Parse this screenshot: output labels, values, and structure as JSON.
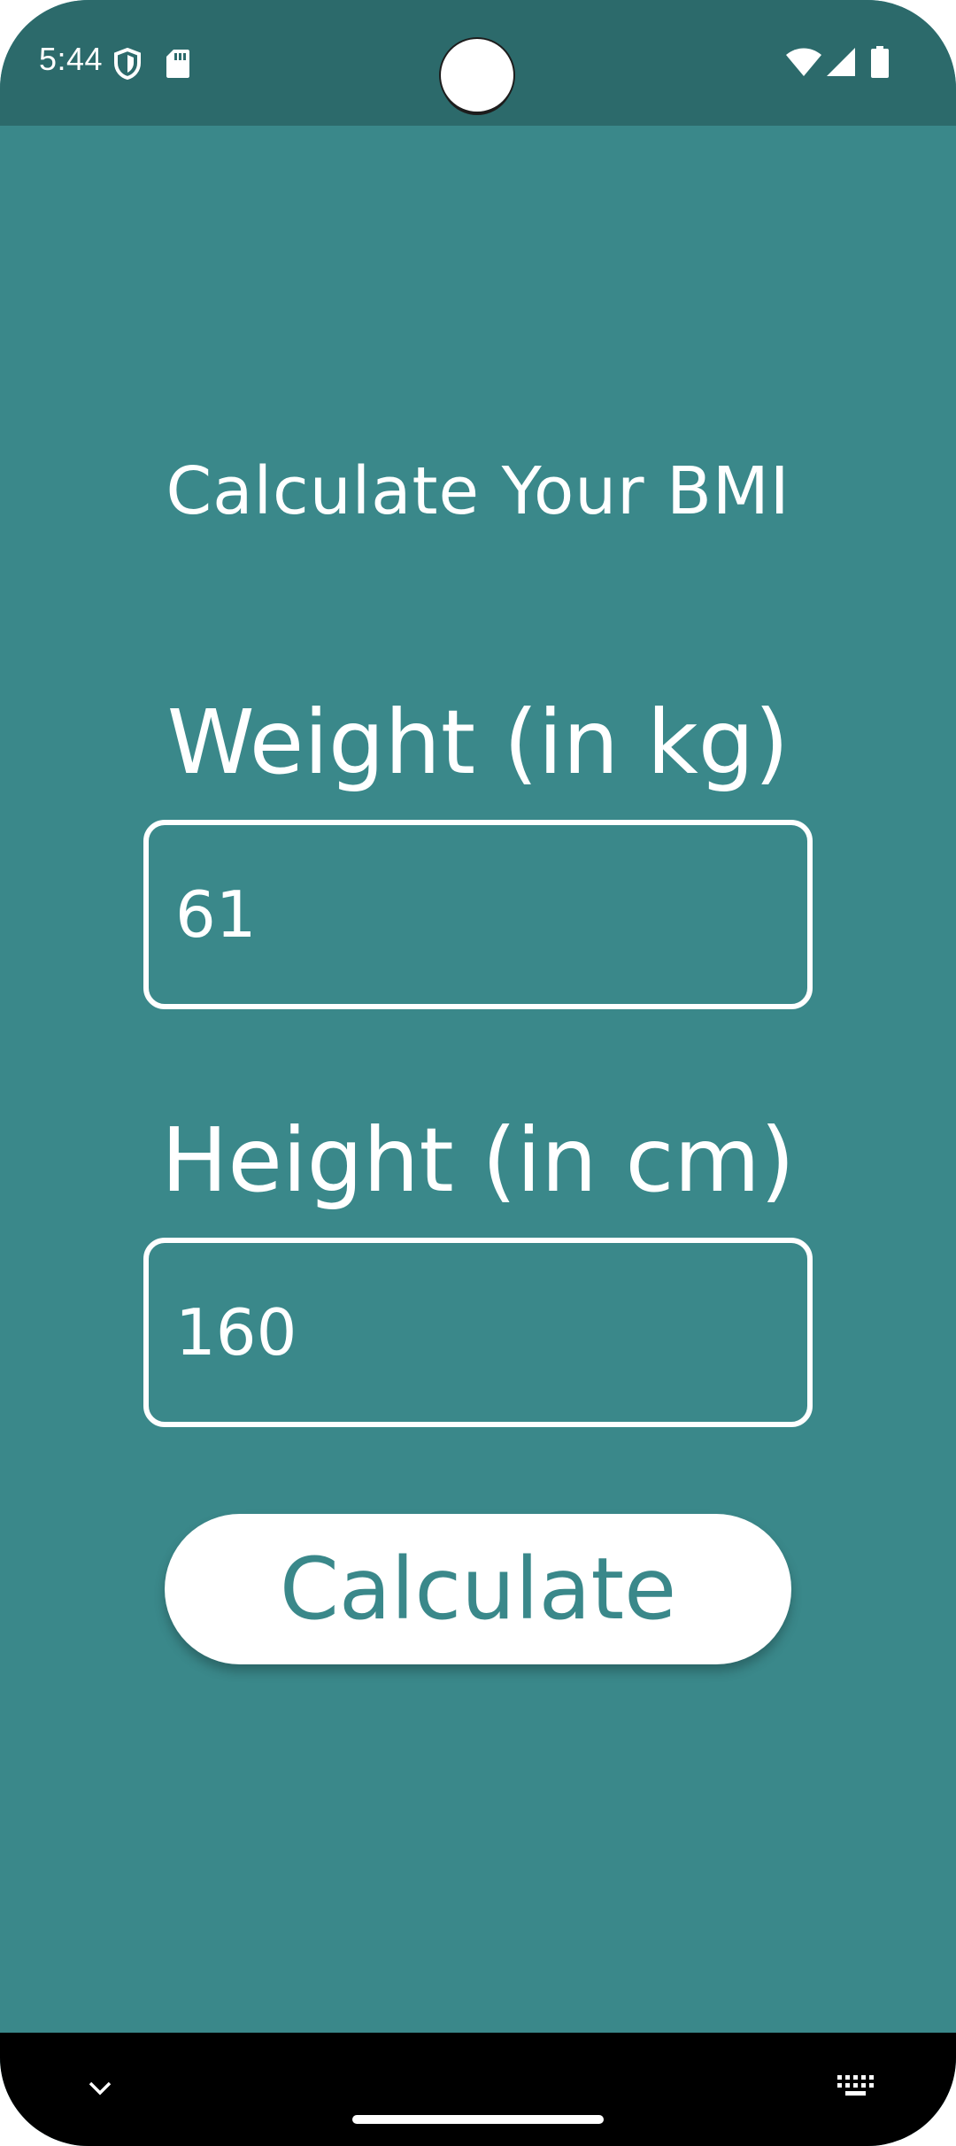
{
  "status_bar": {
    "time": "5:44",
    "icons": [
      "shield-icon",
      "sd-card-icon",
      "wifi-icon",
      "signal-icon",
      "battery-icon"
    ]
  },
  "colors": {
    "background": "#3a888a",
    "status_bar": "#2c6a6b",
    "foreground": "#ffffff",
    "accent": "#3a888a"
  },
  "main": {
    "title": "Calculate Your BMI",
    "weight": {
      "label": "Weight (in kg)",
      "value": "61"
    },
    "height": {
      "label": "Height (in cm)",
      "value": "160"
    },
    "calculate_button": "Calculate"
  },
  "nav_bar": {
    "icons": [
      "chevron-down-icon",
      "keyboard-icon"
    ]
  }
}
